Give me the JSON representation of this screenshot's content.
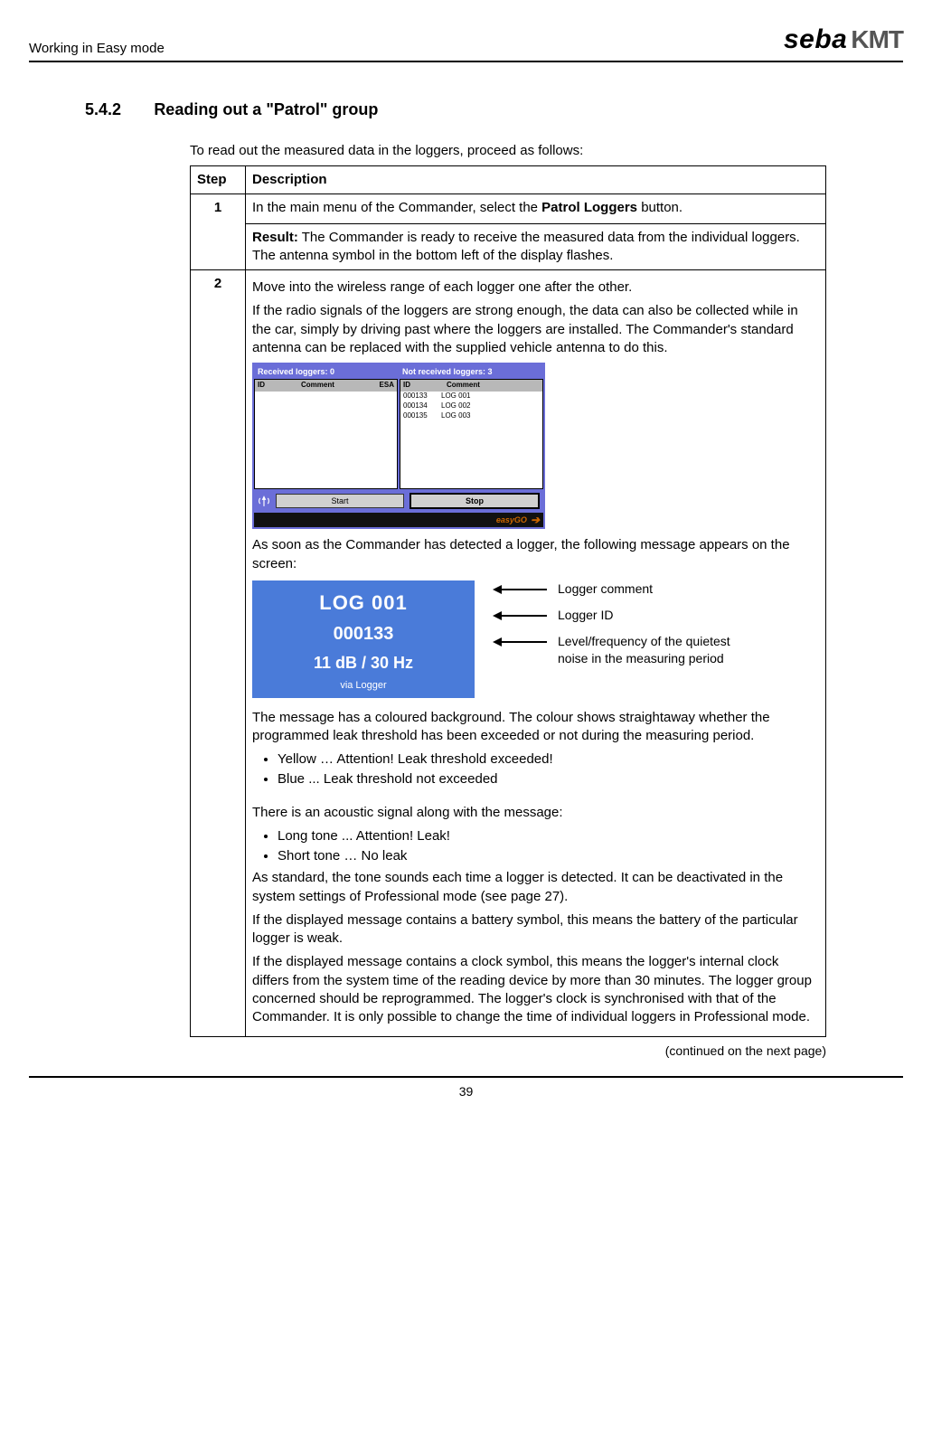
{
  "header": {
    "left": "Working in Easy mode",
    "logo_seba": "seba",
    "logo_kmt": "KMT"
  },
  "section": {
    "num": "5.4.2",
    "title": "Reading out a \"Patrol\" group"
  },
  "intro": "To read out the measured data in the loggers, proceed as follows:",
  "table": {
    "h1": "Step",
    "h2": "Description",
    "r1": {
      "step": "1",
      "line1_a": "In the main menu of the Commander, select the ",
      "line1_bold": "Patrol Loggers",
      "line1_b": " button.",
      "result_label": "Result:",
      "result_text": " The Commander is ready to receive the measured data from the individual loggers. The antenna symbol in the bottom left of the display flashes."
    },
    "r2": {
      "step": "2",
      "p1": "Move into the wireless range of each logger one after the other.",
      "p2": "If the radio signals of the loggers are strong enough, the data can also be collected while in the car, simply by driving past where the loggers are installed. The Commander's standard antenna can be replaced with the supplied vehicle antenna to do this.",
      "commander": {
        "head_left": "Received loggers: 0",
        "head_right": "Not received loggers: 3",
        "col_id": "ID",
        "col_comment": "Comment",
        "col_esa": "ESA",
        "rows": [
          {
            "id": "000133",
            "comment": "LOG 001"
          },
          {
            "id": "000134",
            "comment": "LOG 002"
          },
          {
            "id": "000135",
            "comment": "LOG 003"
          }
        ],
        "btn_start": "Start",
        "btn_stop": "Stop",
        "easygo": "easyGO"
      },
      "p3": "As soon as the Commander has detected a logger, the following message appears on the screen:",
      "bluebox": {
        "l1": "LOG 001",
        "l2": "000133",
        "l3": "11 dB / 30 Hz",
        "l4": "via Logger"
      },
      "annot1": "Logger comment",
      "annot2": "Logger ID",
      "annot3": "Level/frequency of the quietest noise in the measuring period",
      "p4": "The message has a coloured background. The colour shows straightaway whether the programmed leak threshold has been exceeded or not during the measuring period.",
      "b1": "Yellow … Attention! Leak threshold exceeded!",
      "b2": "Blue ... Leak threshold not exceeded",
      "p5": "There is an acoustic signal along with the message:",
      "b3": "Long tone ... Attention! Leak!",
      "b4": "Short tone … No leak",
      "p6": "As standard, the tone sounds each time a logger is detected. It can be deactivated in the system settings of Professional mode (see page 27).",
      "p7": "If the displayed message contains a battery symbol, this means the battery of the particular logger is weak.",
      "p8": "If the displayed message contains a clock symbol, this means the logger's internal clock differs from the system time of the reading device by more than 30 minutes. The logger group concerned should be reprogrammed. The logger's clock is synchronised with that of the Commander. It is only possible to change the time of individual loggers in Professional mode."
    }
  },
  "continued": "(continued on the next page)",
  "page_num": "39"
}
